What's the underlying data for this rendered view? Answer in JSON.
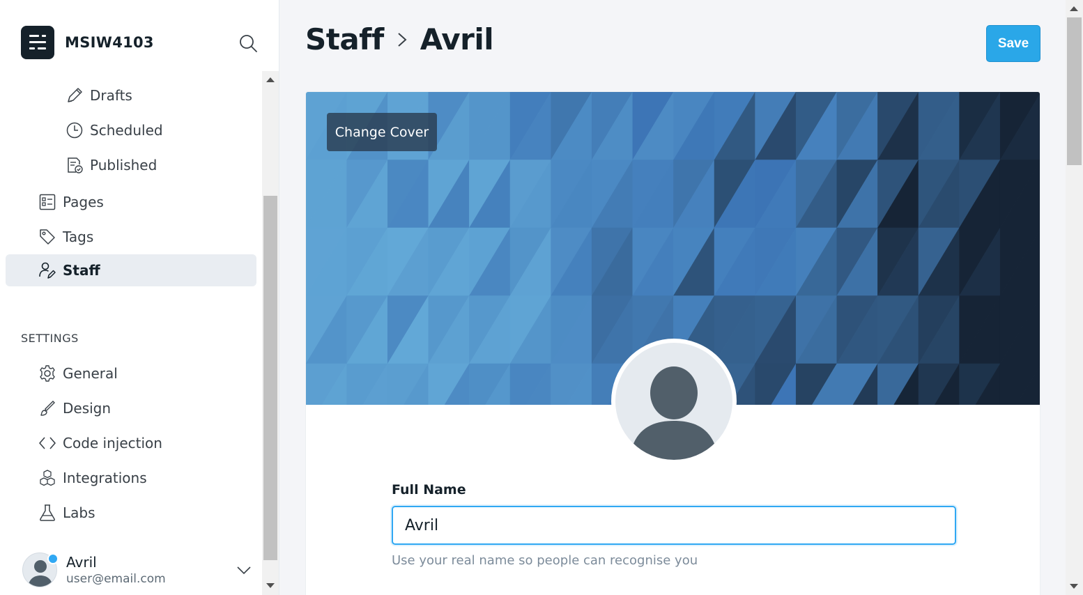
{
  "brand": {
    "name": "MSIW4103"
  },
  "sidebar": {
    "posts_sub": [
      {
        "label": "Drafts",
        "icon": "pencil-icon"
      },
      {
        "label": "Scheduled",
        "icon": "clock-icon"
      },
      {
        "label": "Published",
        "icon": "published-icon"
      }
    ],
    "items": [
      {
        "label": "Pages",
        "icon": "pages-icon"
      },
      {
        "label": "Tags",
        "icon": "tag-icon"
      },
      {
        "label": "Staff",
        "icon": "staff-icon",
        "active": true
      }
    ],
    "settings_heading": "SETTINGS",
    "settings": [
      {
        "label": "General",
        "icon": "gear-icon"
      },
      {
        "label": "Design",
        "icon": "brush-icon"
      },
      {
        "label": "Code injection",
        "icon": "code-icon"
      },
      {
        "label": "Integrations",
        "icon": "integrations-icon"
      },
      {
        "label": "Labs",
        "icon": "flask-icon"
      }
    ]
  },
  "user": {
    "name": "Avril",
    "email": "user@email.com"
  },
  "header": {
    "crumb_parent": "Staff",
    "crumb_current": "Avril",
    "save_label": "Save"
  },
  "cover": {
    "change_label": "Change Cover"
  },
  "form": {
    "full_name_label": "Full Name",
    "full_name_value": "Avril",
    "full_name_help": "Use your real name so people can recognise you"
  },
  "colors": {
    "accent": "#30a8f3",
    "save": "#2aa7e8",
    "text": "#15212a"
  }
}
